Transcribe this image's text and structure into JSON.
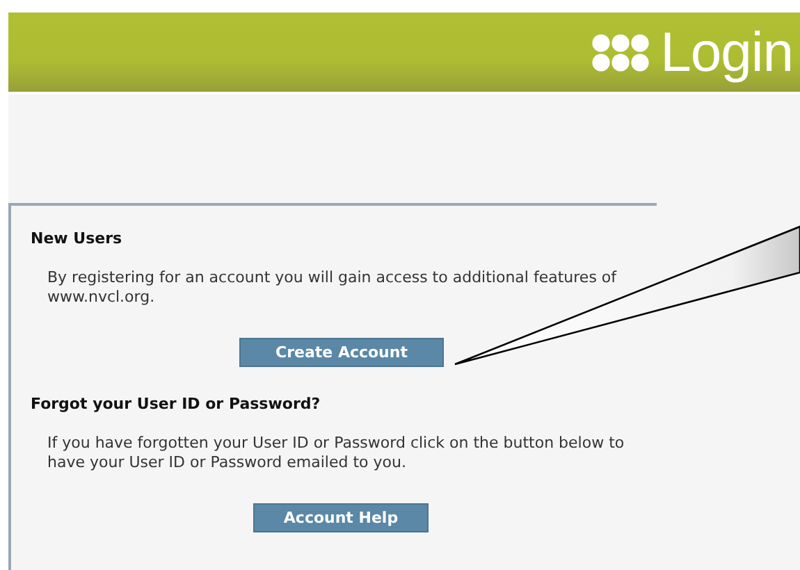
{
  "header": {
    "title": "Login"
  },
  "sections": [
    {
      "heading": "New Users",
      "text": "By registering for an account you will gain access to additional features of www.nvcl.org.",
      "button": "Create Account"
    },
    {
      "heading": "Forgot your User ID or Password?",
      "text": "If you have forgotten your User ID or Password click on the button below to have your User ID or Password emailed to you.",
      "button": "Account Help"
    }
  ]
}
